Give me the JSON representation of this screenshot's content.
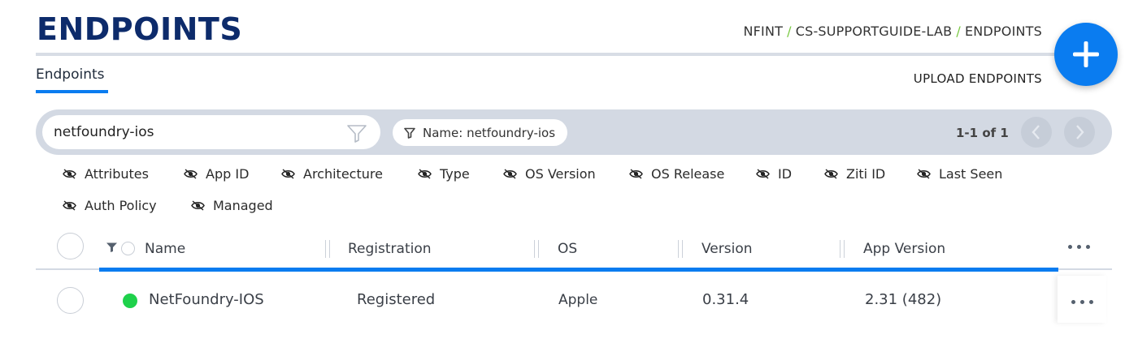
{
  "header": {
    "title": "ENDPOINTS",
    "breadcrumb": [
      "NFINT",
      "CS-SUPPORTGUIDE-LAB",
      "ENDPOINTS"
    ],
    "breadcrumb_separator": "/",
    "add_icon": "plus-icon"
  },
  "tabs": [
    {
      "label": "Endpoints",
      "active": true
    }
  ],
  "actions": {
    "upload_label": "UPLOAD ENDPOINTS"
  },
  "filter": {
    "search_value": "netfoundry-ios",
    "search_icon": "funnel-icon",
    "chip_label": "Name: netfoundry-ios",
    "pagination": "1-1 of 1"
  },
  "column_toggles": [
    "Attributes",
    "App ID",
    "Architecture",
    "Type",
    "OS Version",
    "OS Release",
    "ID",
    "Ziti ID",
    "Last Seen",
    "Auth Policy",
    "Managed"
  ],
  "table": {
    "columns": [
      "Name",
      "Registration",
      "OS",
      "Version",
      "App Version"
    ],
    "rows": [
      {
        "name": "NetFoundry-IOS",
        "registration": "Registered",
        "os": "Apple",
        "version": "0.31.4",
        "app_version": "2.31 (482)",
        "status": "online"
      }
    ]
  },
  "colors": {
    "accent": "#0a7cf0",
    "brand": "#0d2b6b",
    "status_online": "#1ed14b",
    "breadcrumb_separator": "#7ac943"
  }
}
